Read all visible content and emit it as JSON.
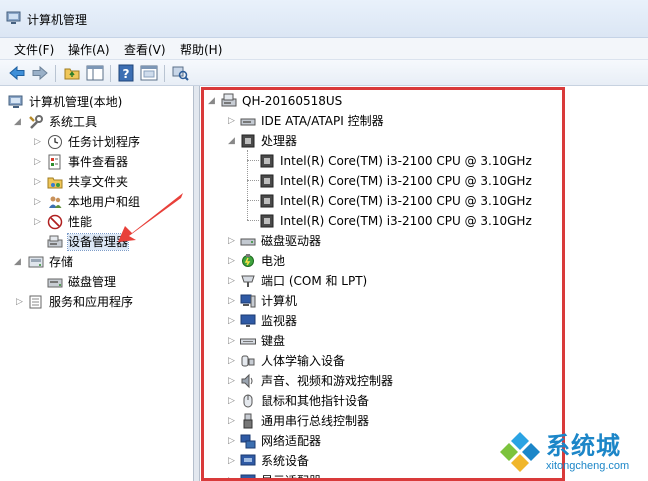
{
  "window": {
    "title": "计算机管理"
  },
  "menu": [
    {
      "label": "文件(F)"
    },
    {
      "label": "操作(A)"
    },
    {
      "label": "查看(V)"
    },
    {
      "label": "帮助(H)"
    }
  ],
  "toolbar": {
    "buttons": [
      "back-icon",
      "forward-icon",
      "up-folder-icon",
      "show-tree-icon",
      "help-icon",
      "properties-icon",
      "scan-hardware-icon"
    ]
  },
  "left_tree": {
    "root": "计算机管理(本地)",
    "system_tools": "系统工具",
    "task_scheduler": "任务计划程序",
    "event_viewer": "事件查看器",
    "shared_folders": "共享文件夹",
    "local_users": "本地用户和组",
    "performance": "性能",
    "device_manager": "设备管理器",
    "storage": "存储",
    "disk_management": "磁盘管理",
    "services_apps": "服务和应用程序"
  },
  "device_tree": {
    "computer_name": "QH-20160518US",
    "ide": "IDE ATA/ATAPI 控制器",
    "processors": "处理器",
    "cpus": [
      "Intel(R) Core(TM) i3-2100 CPU @ 3.10GHz",
      "Intel(R) Core(TM) i3-2100 CPU @ 3.10GHz",
      "Intel(R) Core(TM) i3-2100 CPU @ 3.10GHz",
      "Intel(R) Core(TM) i3-2100 CPU @ 3.10GHz"
    ],
    "categories": [
      "磁盘驱动器",
      "电池",
      "端口 (COM 和 LPT)",
      "计算机",
      "监视器",
      "键盘",
      "人体学输入设备",
      "声音、视频和游戏控制器",
      "鼠标和其他指针设备",
      "通用串行总线控制器",
      "网络适配器",
      "系统设备",
      "显示适配器"
    ]
  },
  "watermark": {
    "title": "系统城",
    "url": "xitongcheng.com"
  },
  "colors": {
    "highlight": "#d93a3a",
    "accent": "#1c86c8"
  }
}
